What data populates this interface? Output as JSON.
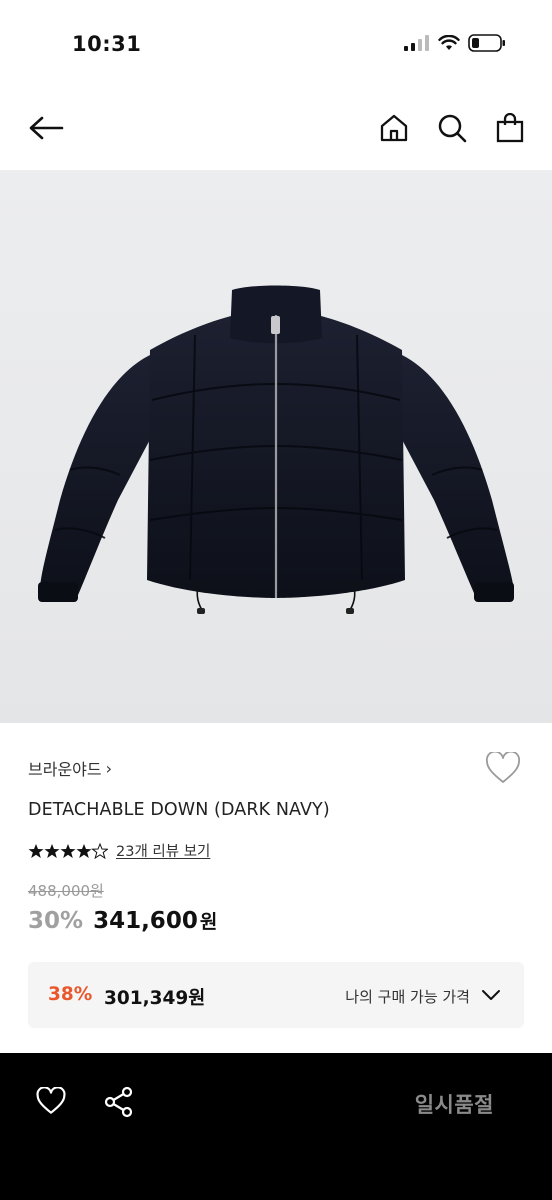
{
  "status_bar": {
    "time": "10:31"
  },
  "top_nav": {
    "icons": [
      "back-arrow-icon",
      "home-icon",
      "search-icon",
      "shopping-bag-icon"
    ]
  },
  "product": {
    "image_icon": "navy-down-jacket",
    "brand": "브라운야드",
    "brand_chevron": "›",
    "title": "DETACHABLE DOWN (DARK NAVY)",
    "rating": 4.5,
    "review_link": "23개 리뷰 보기",
    "original_price": "488,000원",
    "discount_rate": "30%",
    "sale_price": "341,600",
    "sale_unit": "원"
  },
  "my_price": {
    "rate": "38%",
    "price": "301,349원",
    "label": "나의 구매 가능 가격"
  },
  "bottom_bar": {
    "soldout_label": "일시품절"
  },
  "colors": {
    "accent_orange": "#e8582c",
    "bottom_bar_bg": "#000000",
    "muted_gray": "#a0a0a0"
  }
}
